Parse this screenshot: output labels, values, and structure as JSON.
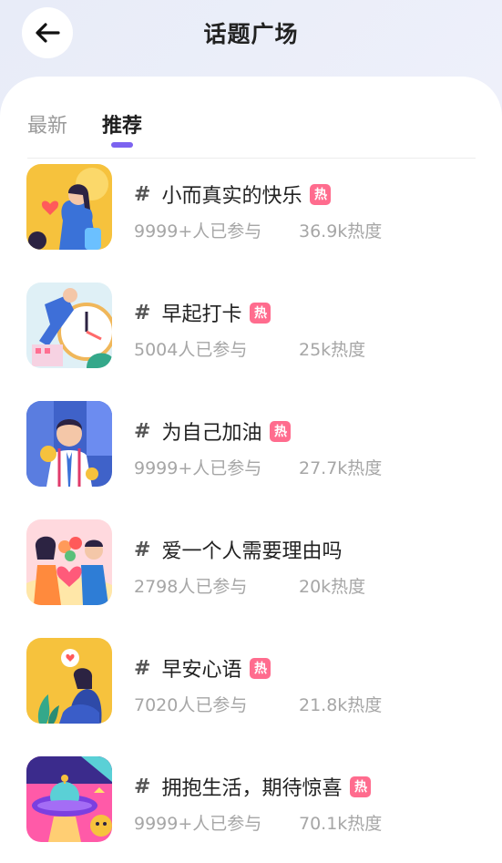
{
  "header": {
    "title": "话题广场",
    "back_icon": "arrow-left-icon"
  },
  "tabs": [
    {
      "label": "最新",
      "active": false
    },
    {
      "label": "推荐",
      "active": true
    }
  ],
  "colors": {
    "accent": "#7c63f0",
    "hot_badge": "#ff6c8e"
  },
  "topics": [
    {
      "hash": "#",
      "title": "小而真实的快乐",
      "hot": true,
      "hot_label": "热",
      "participants": "9999+人已参与",
      "heat": "36.9k热度"
    },
    {
      "hash": "#",
      "title": "早起打卡",
      "hot": true,
      "hot_label": "热",
      "participants": "5004人已参与",
      "heat": "25k热度"
    },
    {
      "hash": "#",
      "title": "为自己加油",
      "hot": true,
      "hot_label": "热",
      "participants": "9999+人已参与",
      "heat": "27.7k热度"
    },
    {
      "hash": "#",
      "title": "爱一个人需要理由吗",
      "hot": false,
      "hot_label": "",
      "participants": "2798人已参与",
      "heat": "20k热度"
    },
    {
      "hash": "#",
      "title": "早安心语",
      "hot": true,
      "hot_label": "热",
      "participants": "7020人已参与",
      "heat": "21.8k热度"
    },
    {
      "hash": "#",
      "title": "拥抱生活，期待惊喜",
      "hot": true,
      "hot_label": "热",
      "participants": "9999+人已参与",
      "heat": "70.1k热度"
    }
  ]
}
